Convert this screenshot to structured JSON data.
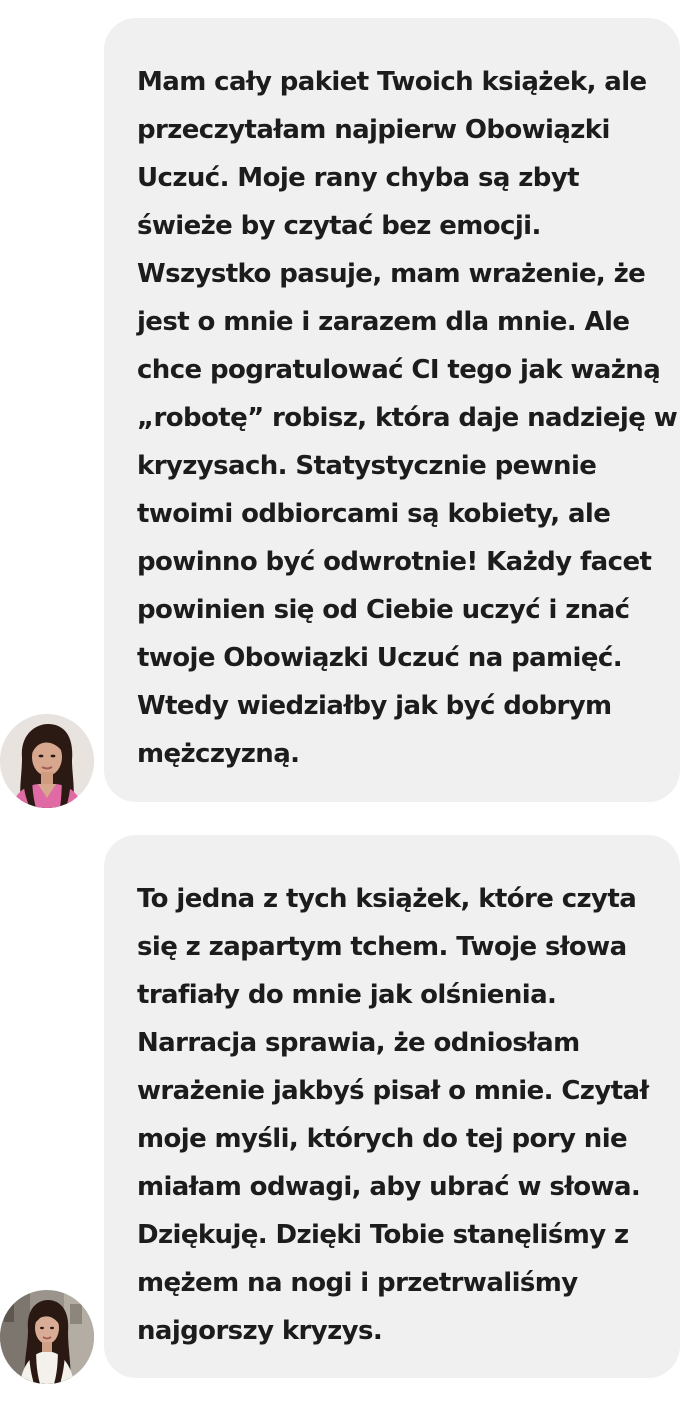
{
  "messages": [
    {
      "lines": [
        "Mam cały pakiet Twoich książek, ale",
        "przeczytałam najpierw Obowiązki",
        "Uczuć. Moje rany chyba są zbyt",
        "świeże by czytać bez emocji.",
        "Wszystko pasuje, mam wrażenie, że",
        "jest o mnie i zarazem dla mnie. Ale",
        "chce pogratulować CI tego jak ważną",
        "„robotę” robisz, która daje nadzieję w",
        "kryzysach. Statystycznie pewnie",
        "twoimi odbiorcami są kobiety, ale",
        "powinno być odwrotnie! Każdy facet",
        "powinien się od Ciebie uczyć i znać",
        "twoje Obowiązki Uczuć na pamięć.",
        "Wtedy wiedziałby jak być dobrym",
        "mężczyzną."
      ]
    },
    {
      "lines": [
        "To jedna z tych książek, które czyta",
        "się z zapartym tchem. Twoje słowa",
        "trafiały do mnie jak olśnienia.",
        "Narracja sprawia, że odniosłam",
        "wrażenie jakbyś pisał o mnie. Czytał",
        "moje myśli, których do tej pory nie",
        "miałam odwagi, aby ubrać w słowa.",
        "Dziękuję. Dzięki Tobie stanęliśmy z",
        "mężem na nogi i przetrwaliśmy",
        "najgorszy kryzys."
      ]
    }
  ],
  "colors": {
    "page_background": "#ffffff",
    "bubble_background": "#f0f0f0",
    "text": "#1c1c1c"
  },
  "icons": [
    "avatar-photo-1",
    "avatar-photo-2"
  ]
}
